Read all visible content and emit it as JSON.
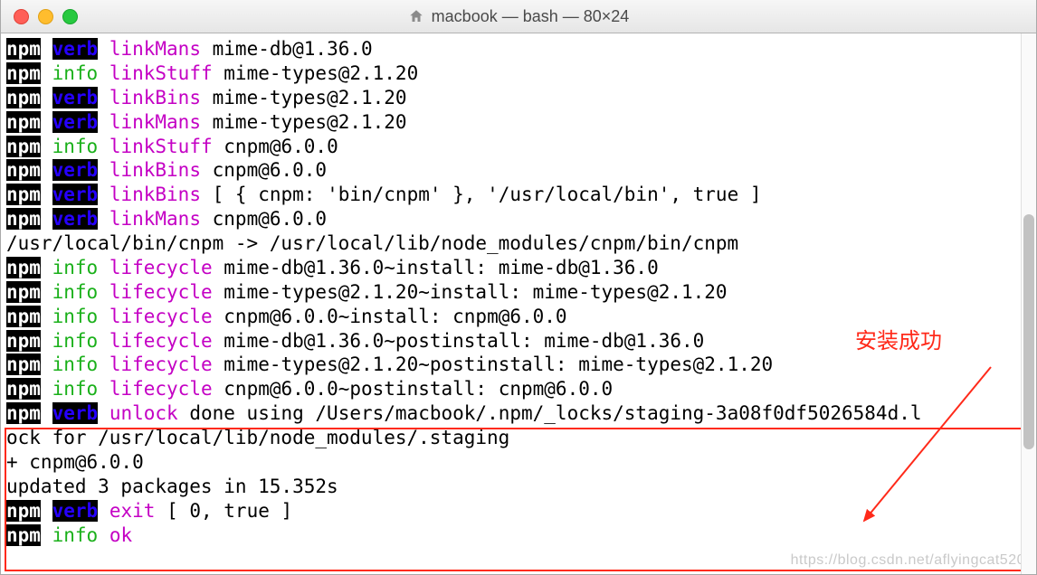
{
  "window": {
    "title": "macbook — bash — 80×24"
  },
  "lines": [
    {
      "npm": true,
      "level": "verb",
      "action": "linkMans",
      "rest": "mime-db@1.36.0"
    },
    {
      "npm": true,
      "level": "info",
      "action": "linkStuff",
      "rest": "mime-types@2.1.20"
    },
    {
      "npm": true,
      "level": "verb",
      "action": "linkBins",
      "rest": "mime-types@2.1.20"
    },
    {
      "npm": true,
      "level": "verb",
      "action": "linkMans",
      "rest": "mime-types@2.1.20"
    },
    {
      "npm": true,
      "level": "info",
      "action": "linkStuff",
      "rest": "cnpm@6.0.0"
    },
    {
      "npm": true,
      "level": "verb",
      "action": "linkBins",
      "rest": "cnpm@6.0.0"
    },
    {
      "npm": true,
      "level": "verb",
      "action": "linkBins",
      "rest": "[ { cnpm: 'bin/cnpm' }, '/usr/local/bin', true ]"
    },
    {
      "npm": true,
      "level": "verb",
      "action": "linkMans",
      "rest": "cnpm@6.0.0"
    },
    {
      "plain": "/usr/local/bin/cnpm -> /usr/local/lib/node_modules/cnpm/bin/cnpm"
    },
    {
      "npm": true,
      "level": "info",
      "action": "lifecycle",
      "rest": "mime-db@1.36.0~install: mime-db@1.36.0"
    },
    {
      "npm": true,
      "level": "info",
      "action": "lifecycle",
      "rest": "mime-types@2.1.20~install: mime-types@2.1.20"
    },
    {
      "npm": true,
      "level": "info",
      "action": "lifecycle",
      "rest": "cnpm@6.0.0~install: cnpm@6.0.0"
    },
    {
      "npm": true,
      "level": "info",
      "action": "lifecycle",
      "rest": "mime-db@1.36.0~postinstall: mime-db@1.36.0"
    },
    {
      "npm": true,
      "level": "info",
      "action": "lifecycle",
      "rest": "mime-types@2.1.20~postinstall: mime-types@2.1.20"
    },
    {
      "npm": true,
      "level": "info",
      "action": "lifecycle",
      "rest": "cnpm@6.0.0~postinstall: cnpm@6.0.0"
    },
    {
      "npm": true,
      "level": "verb",
      "action": "unlock",
      "rest": "done using /Users/macbook/.npm/_locks/staging-3a08f0df5026584d.l"
    },
    {
      "plain": "ock for /usr/local/lib/node_modules/.staging"
    },
    {
      "plain": "+ cnpm@6.0.0"
    },
    {
      "plain": "updated 3 packages in 15.352s"
    },
    {
      "npm": true,
      "level": "verb",
      "action": "exit",
      "rest": "[ 0, true ]"
    },
    {
      "npm": true,
      "level": "info",
      "action": "ok",
      "rest": ""
    }
  ],
  "annotation": {
    "text": "安装成功"
  },
  "watermark": "https://blog.csdn.net/aflyingcat520"
}
